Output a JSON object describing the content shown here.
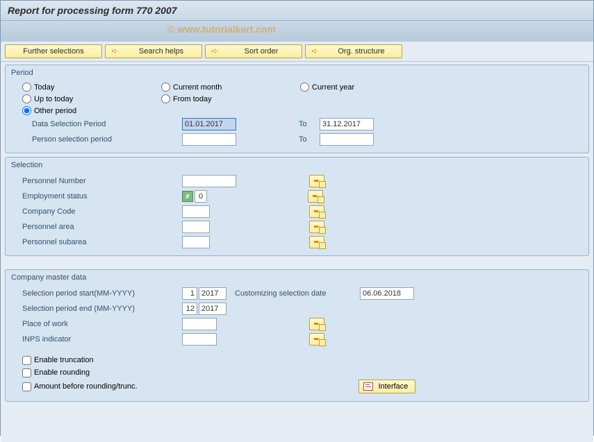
{
  "title": "Report for processing form 770 2007",
  "watermark": "© www.tutorialkart.com",
  "toolbar": {
    "further_selections": "Further selections",
    "search_helps": "Search helps",
    "sort_order": "Sort order",
    "org_structure": "Org. structure"
  },
  "period": {
    "group_title": "Period",
    "today": "Today",
    "current_month": "Current month",
    "current_year": "Current year",
    "up_to_today": "Up to today",
    "from_today": "From today",
    "other_period": "Other period",
    "selected": "other_period",
    "data_sel_label": "Data Selection Period",
    "data_sel_from": "01.01.2017",
    "to_label": "To",
    "data_sel_to": "31.12.2017",
    "person_sel_label": "Person selection period",
    "person_sel_from": "",
    "person_sel_to": ""
  },
  "selection": {
    "group_title": "Selection",
    "personnel_number": "Personnel Number",
    "personnel_number_val": "",
    "employment_status": "Employment status",
    "employment_status_val": "0",
    "company_code": "Company Code",
    "company_code_val": "",
    "personnel_area": "Personnel area",
    "personnel_area_val": "",
    "personnel_subarea": "Personnel subarea",
    "personnel_subarea_val": ""
  },
  "company": {
    "group_title": "Company master data",
    "sel_start_label": "Selection period start(MM-YYYY)",
    "sel_start_mm": "1",
    "sel_start_yyyy": "2017",
    "cust_date_label": "Customizing selection date",
    "cust_date_val": "06.06.2018",
    "sel_end_label": "Selection period end (MM-YYYY)",
    "sel_end_mm": "12",
    "sel_end_yyyy": "2017",
    "place_of_work": "Place of work",
    "place_of_work_val": "",
    "inps_indicator": "INPS indicator",
    "inps_indicator_val": "",
    "enable_trunc": "Enable truncation",
    "enable_round": "Enable rounding",
    "amount_before": "Amount before rounding/trunc.",
    "interface_label": "Interface"
  }
}
